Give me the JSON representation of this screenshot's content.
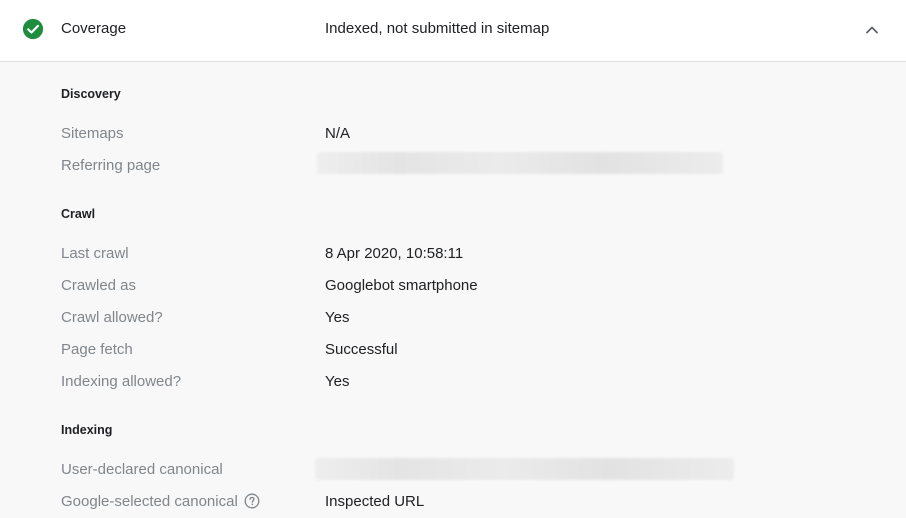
{
  "header": {
    "label": "Coverage",
    "value": "Indexed, not submitted in sitemap",
    "status_icon": "check-circle-icon",
    "status_color": "#1e8e3e",
    "collapse_icon": "chevron-up-icon"
  },
  "discovery": {
    "title": "Discovery",
    "rows": [
      {
        "label": "Sitemaps",
        "value": "N/A"
      },
      {
        "label": "Referring page",
        "value": ""
      }
    ]
  },
  "crawl": {
    "title": "Crawl",
    "rows": [
      {
        "label": "Last crawl",
        "value": "8 Apr 2020, 10:58:11"
      },
      {
        "label": "Crawled as",
        "value": "Googlebot smartphone"
      },
      {
        "label": "Crawl allowed?",
        "value": "Yes"
      },
      {
        "label": "Page fetch",
        "value": "Successful"
      },
      {
        "label": "Indexing allowed?",
        "value": "Yes"
      }
    ]
  },
  "indexing": {
    "title": "Indexing",
    "rows": [
      {
        "label": "User-declared canonical",
        "value": ""
      },
      {
        "label": "Google-selected canonical",
        "value": "Inspected URL",
        "icon": "help-circle-icon"
      }
    ]
  }
}
